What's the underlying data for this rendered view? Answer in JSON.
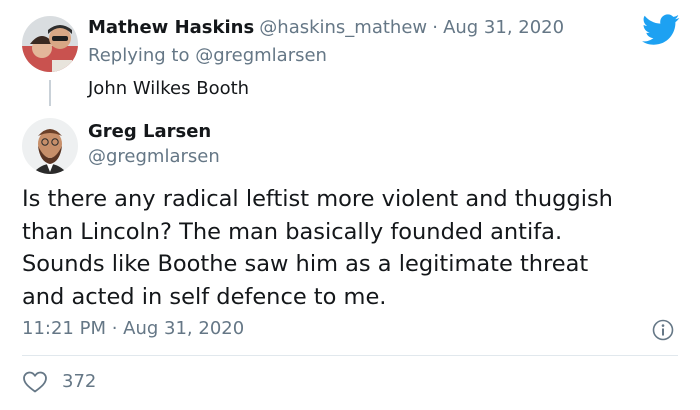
{
  "parent_tweet": {
    "display_name": "Mathew Haskins",
    "handle": "@haskins_mathew",
    "separator": "·",
    "date": "Aug 31, 2020",
    "replying_to": "Replying to @gregmlarsen",
    "text": "John Wilkes Booth"
  },
  "reply_tweet": {
    "display_name": "Greg Larsen",
    "handle": "@gregmlarsen",
    "text": "Is there any radical leftist more violent and thuggish\nthan Lincoln? The man basically founded antifa.\nSounds like Boothe saw him as a legitimate threat\nand acted in self defence to me.",
    "timestamp": "11:21 PM · Aug 31, 2020",
    "like_count": "372"
  },
  "icons": {
    "brand": "twitter-bird-icon",
    "info": "info-icon",
    "like": "heart-icon"
  },
  "colors": {
    "brand_blue": "#1da1f2",
    "muted_text": "#657786",
    "divider": "#e1e8ed"
  }
}
